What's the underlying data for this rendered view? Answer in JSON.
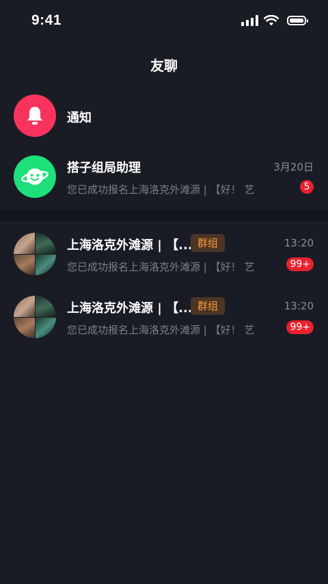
{
  "status_bar": {
    "time": "9:41"
  },
  "header": {
    "title": "友聊"
  },
  "colors": {
    "background": "#1a1c25",
    "notice_avatar": "#f8345e",
    "assistant_avatar": "#1ee07a",
    "badge": "#e8212f",
    "group_tag_bg": "#4a3526",
    "group_tag_text": "#ff9a36"
  },
  "notice": {
    "name": "通知",
    "icon": "bell-icon"
  },
  "assistant": {
    "name": "搭子组局助理",
    "preview": "您已成功报名上海洛克外滩源 | 【好！ 艺",
    "time": "3月20日",
    "badge": "5",
    "icon": "smiling-planet-icon"
  },
  "groups": [
    {
      "name": "上海洛克外滩源 | 【...",
      "tag": "群组",
      "preview": "您已成功报名上海洛克外滩源 | 【好！ 艺",
      "time": "13:20",
      "badge": "99+"
    },
    {
      "name": "上海洛克外滩源 | 【...",
      "tag": "群组",
      "preview": "您已成功报名上海洛克外滩源 | 【好！ 艺",
      "time": "13:20",
      "badge": "99+"
    }
  ]
}
